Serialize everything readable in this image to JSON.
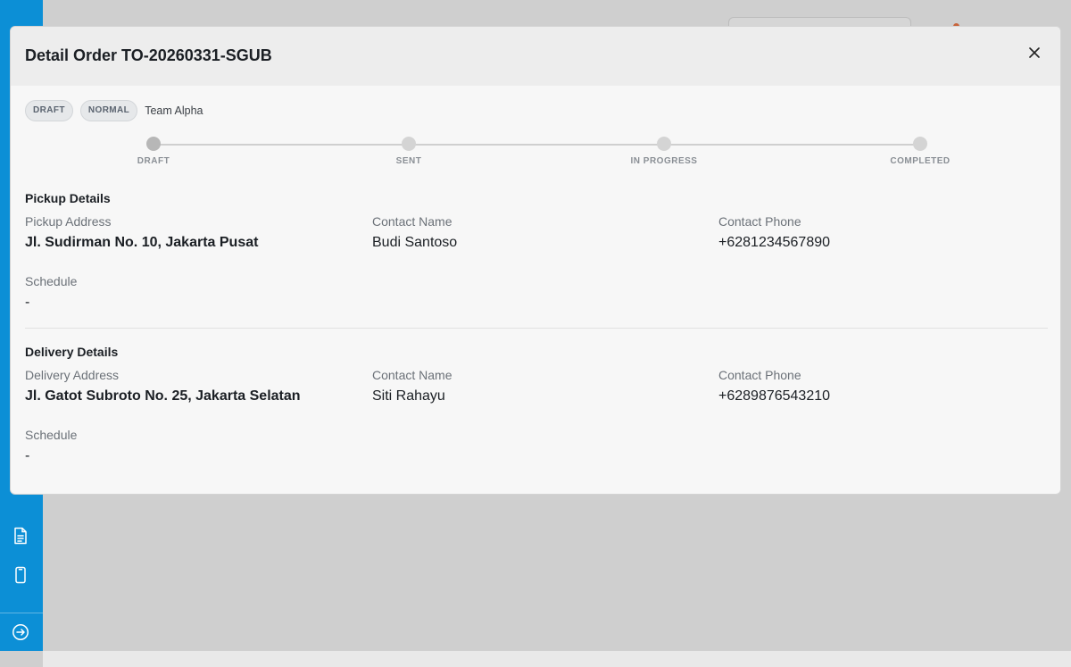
{
  "modal": {
    "title": "Detail Order TO-20260331-SGUB",
    "badges": [
      "DRAFT",
      "NORMAL"
    ],
    "team": "Team Alpha",
    "steps": [
      "DRAFT",
      "SENT",
      "IN PROGRESS",
      "COMPLETED"
    ],
    "current_step": "DRAFT"
  },
  "pickup": {
    "title": "Pickup Details",
    "address_label": "Pickup Address",
    "address": "Jl. Sudirman No. 10, Jakarta Pusat",
    "contact_name_label": "Contact Name",
    "contact_name": "Budi Santoso",
    "contact_phone_label": "Contact Phone",
    "contact_phone": "+6281234567890",
    "schedule_label": "Schedule",
    "schedule": "-"
  },
  "delivery": {
    "title": "Delivery Details",
    "address_label": "Delivery Address",
    "address": "Jl. Gatot Subroto No. 25, Jakarta Selatan",
    "contact_name_label": "Contact Name",
    "contact_name": "Siti Rahayu",
    "contact_phone_label": "Contact Phone",
    "contact_phone": "+6289876543210",
    "schedule_label": "Schedule",
    "schedule": "-"
  },
  "icons": {
    "close": "close-icon",
    "sidebar": [
      "document-icon",
      "mobile-icon",
      "logout-icon"
    ]
  },
  "colors": {
    "sidebar": "#0c8fd6",
    "overlay": "#cfcfcf",
    "modal_bg": "#f7f7f7"
  }
}
